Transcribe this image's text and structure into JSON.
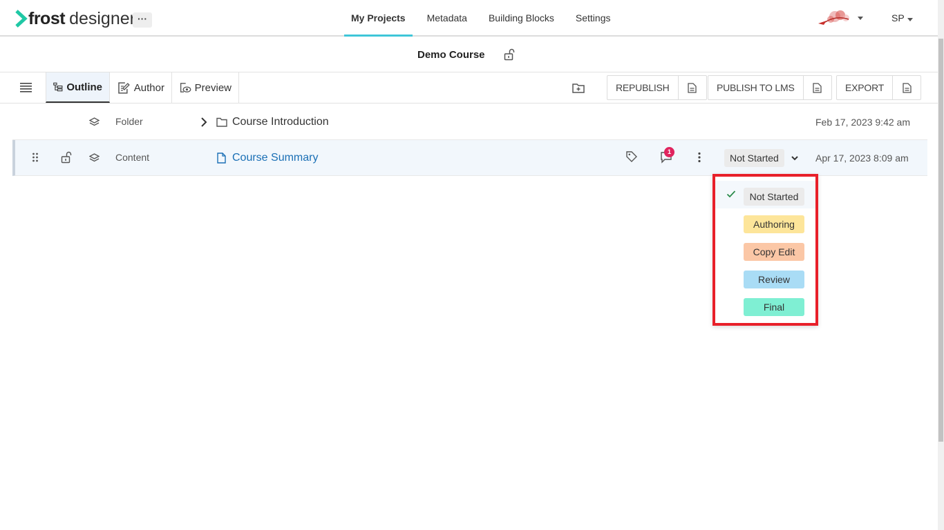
{
  "app": {
    "logo_main": "frost",
    "logo_sub": "designer",
    "more_label": "···",
    "nav": [
      "My Projects",
      "Metadata",
      "Building Blocks",
      "Settings"
    ],
    "user_initials": "SP"
  },
  "course": {
    "title": "Demo Course"
  },
  "toolbar": {
    "tabs": [
      "Outline",
      "Author",
      "Preview"
    ],
    "republish": "REPUBLISH",
    "publish_lms": "PUBLISH TO LMS",
    "export": "EXPORT"
  },
  "rows": [
    {
      "type": "Folder",
      "title": "Course Introduction",
      "date": "Feb 17, 2023 9:42 am"
    },
    {
      "type": "Content",
      "title": "Course Summary",
      "comment_count": "1",
      "status": "Not Started",
      "date": "Apr 17, 2023 8:09 am"
    }
  ],
  "status_menu": {
    "options": [
      {
        "label": "Not Started",
        "color": "#ebebeb",
        "selected": true
      },
      {
        "label": "Authoring",
        "color": "#fde59a",
        "selected": false
      },
      {
        "label": "Copy Edit",
        "color": "#fbc7a6",
        "selected": false
      },
      {
        "label": "Review",
        "color": "#a9dcf5",
        "selected": false
      },
      {
        "label": "Final",
        "color": "#7fefd3",
        "selected": false
      }
    ]
  },
  "colors": {
    "accent": "#3ec6d8",
    "link": "#1a6fb5",
    "highlight_border": "#e8202a",
    "logo_green": "#1fc8a5"
  }
}
